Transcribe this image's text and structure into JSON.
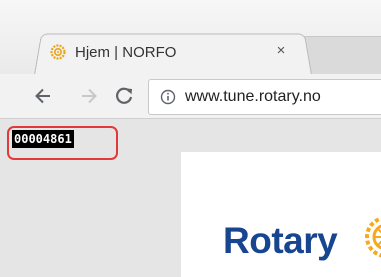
{
  "browser": {
    "tab": {
      "title": "Hjem | NORFO",
      "close_glyph": "×",
      "favicon": "rotary-wheel-icon"
    },
    "toolbar": {
      "back_icon": "arrow-left-icon",
      "forward_icon": "arrow-right-icon",
      "reload_glyph": "C",
      "info_icon": "info-icon",
      "url": "www.tune.rotary.no"
    }
  },
  "overlay": {
    "id_label": "00004861",
    "callout_color": "#e03a3a"
  },
  "page": {
    "brand_name": "Rotary",
    "brand_color": "#17458f",
    "wheel_color": "#f7a81b"
  }
}
